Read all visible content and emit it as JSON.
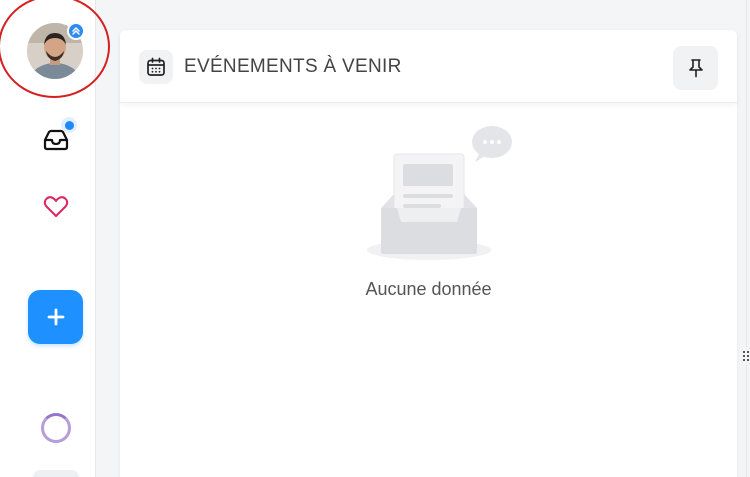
{
  "sidebar": {
    "avatar_alt": "User avatar",
    "inbox_has_unread": true,
    "add_label": "+"
  },
  "card": {
    "title": "EVÉNEMENTS À VENIR",
    "empty_text": "Aucune donnée"
  },
  "icons": {
    "avatar_badge": "double-chevron-up-icon",
    "inbox": "inbox-icon",
    "heart": "heart-icon",
    "add": "plus-icon",
    "calendar": "calendar-icon",
    "pin": "pin-icon"
  },
  "colors": {
    "accent": "#1e90ff",
    "heart": "#e0245e",
    "highlight": "#d62020",
    "loader": "#9575cd"
  }
}
